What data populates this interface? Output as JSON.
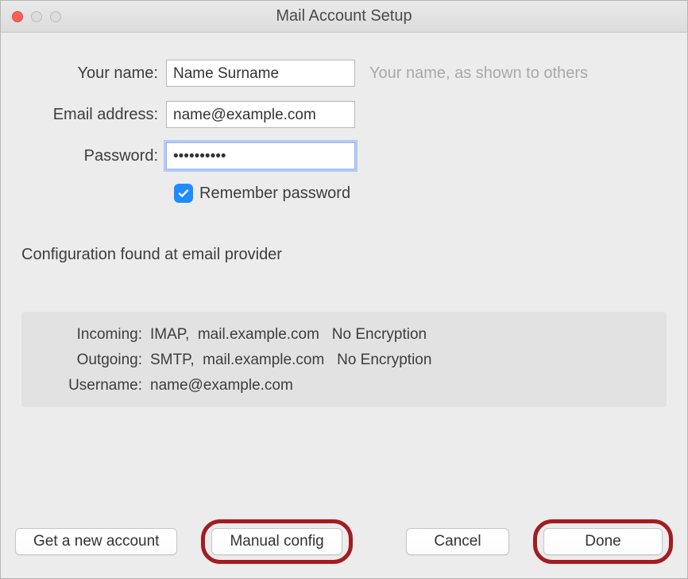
{
  "window": {
    "title": "Mail Account Setup"
  },
  "form": {
    "name_label": "Your name:",
    "name_value": "Name Surname",
    "name_hint": "Your name, as shown to others",
    "email_label": "Email address:",
    "email_value": "name@example.com",
    "password_label": "Password:",
    "password_value": "••••••••••",
    "remember_label": "Remember password"
  },
  "status": "Configuration found at email provider",
  "details": {
    "incoming_label": "Incoming:",
    "incoming_value": "IMAP,  mail.example.com   No Encryption",
    "outgoing_label": "Outgoing:",
    "outgoing_value": "SMTP,  mail.example.com   No Encryption",
    "username_label": "Username:",
    "username_value": "name@example.com"
  },
  "buttons": {
    "new_account": "Get a new account",
    "manual_config": "Manual config",
    "cancel": "Cancel",
    "done": "Done"
  }
}
